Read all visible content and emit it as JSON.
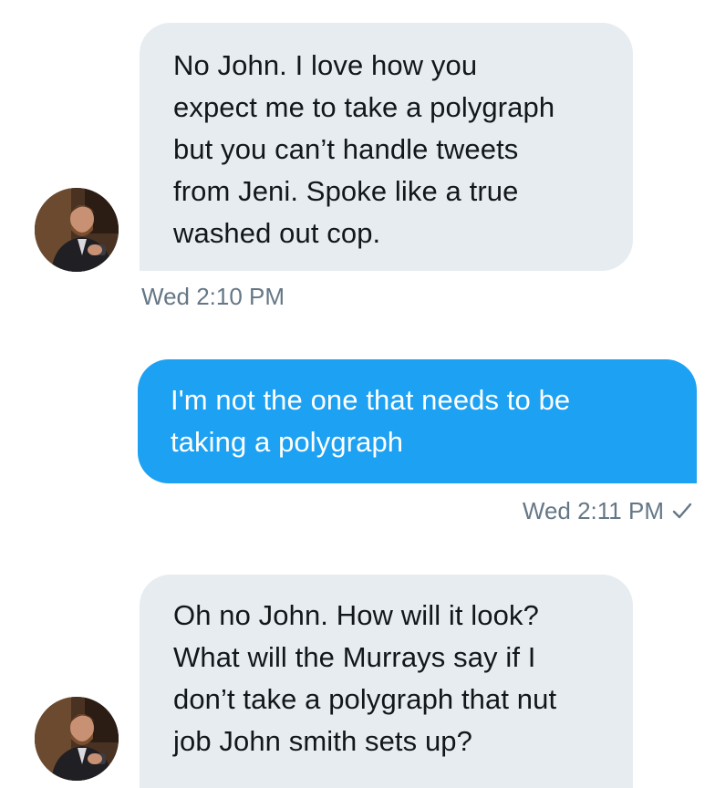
{
  "conversation": {
    "messages": [
      {
        "direction": "incoming",
        "lines": [
          "No John. I love how you",
          "expect me to take a polygraph",
          "but you can’t handle tweets",
          "from Jeni. Spoke like a true",
          "washed out cop."
        ],
        "timestamp": "Wed 2:10 PM"
      },
      {
        "direction": "outgoing",
        "lines": [
          "I'm not the one that needs to be",
          "taking a polygraph"
        ],
        "timestamp": "Wed 2:11 PM",
        "status_icon": "checkmark-icon"
      },
      {
        "direction": "incoming",
        "lines": [
          "Oh no John. How will it look?",
          "What will the Murrays say if I",
          "don’t take a polygraph that nut",
          "job John smith sets up?"
        ]
      }
    ]
  },
  "colors": {
    "incoming_bubble": "#e6ecf0",
    "outgoing_bubble": "#1da1f2",
    "timestamp_text": "#657786"
  }
}
